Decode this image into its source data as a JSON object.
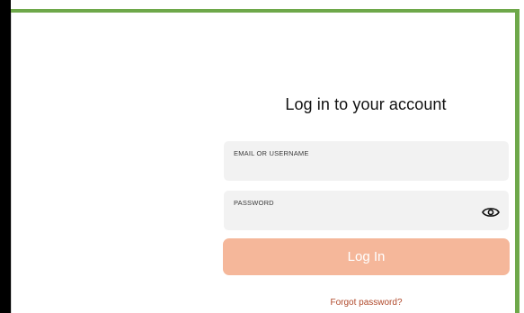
{
  "login": {
    "title": "Log in to your account",
    "email_label": "EMAIL OR USERNAME",
    "email_value": "",
    "password_label": "PASSWORD",
    "password_value": "",
    "submit_label": "Log In",
    "forgot_label": "Forgot password?"
  },
  "icons": {
    "password_toggle": "eye-icon"
  },
  "colors": {
    "frame_border": "#6ea84a",
    "button_background": "#f5b79a",
    "button_text": "#ffffff",
    "link": "#b0492b",
    "field_background": "#f2f2f2"
  }
}
